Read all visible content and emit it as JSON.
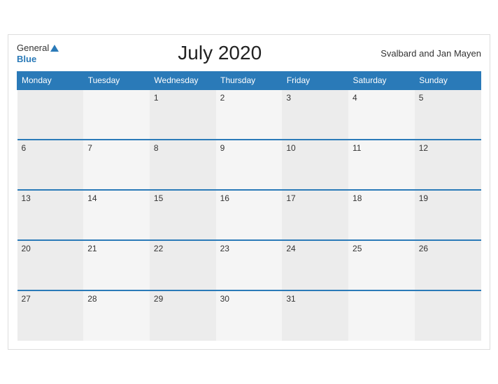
{
  "header": {
    "logo_general": "General",
    "logo_blue": "Blue",
    "title": "July 2020",
    "region": "Svalbard and Jan Mayen"
  },
  "days_of_week": [
    "Monday",
    "Tuesday",
    "Wednesday",
    "Thursday",
    "Friday",
    "Saturday",
    "Sunday"
  ],
  "weeks": [
    [
      "",
      "",
      "1",
      "2",
      "3",
      "4",
      "5"
    ],
    [
      "6",
      "7",
      "8",
      "9",
      "10",
      "11",
      "12"
    ],
    [
      "13",
      "14",
      "15",
      "16",
      "17",
      "18",
      "19"
    ],
    [
      "20",
      "21",
      "22",
      "23",
      "24",
      "25",
      "26"
    ],
    [
      "27",
      "28",
      "29",
      "30",
      "31",
      "",
      ""
    ]
  ]
}
